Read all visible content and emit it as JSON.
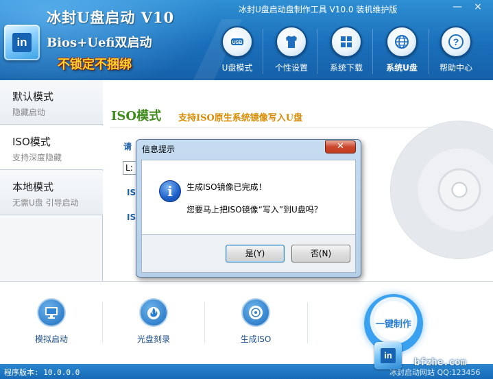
{
  "app": {
    "title": "冰封U盘启动 V10",
    "subtitle": "Bios+Uefi双启动",
    "slogan": "不锁定不捆绑",
    "logo_text": "in",
    "window_title": "冰封U盘启动盘制作工具 V10.0 装机维护版",
    "minimize_symbol": "—",
    "close_symbol": "×"
  },
  "nav": {
    "items": [
      {
        "label": "U盘模式",
        "icon": "usb-icon"
      },
      {
        "label": "个性设置",
        "icon": "tshirt-icon"
      },
      {
        "label": "系统下载",
        "icon": "windows-icon"
      },
      {
        "label": "系统U盘",
        "icon": "globe-icon",
        "active": true
      },
      {
        "label": "帮助中心",
        "icon": "question-icon"
      }
    ]
  },
  "modes": [
    {
      "title": "默认模式",
      "subtitle": "隐藏启动"
    },
    {
      "title": "ISO模式",
      "subtitle": "支持深度隐藏",
      "active": true
    },
    {
      "title": "本地模式",
      "subtitle": "无需U盘 引导启动"
    }
  ],
  "main": {
    "mode_title": "ISO模式",
    "mode_desc": "支持ISO原生系统镜像写入U盘",
    "select_prompt": "请",
    "drive_value": "L:",
    "iso_row1": "IS",
    "iso_row2": "IS"
  },
  "toolbar": {
    "items": [
      {
        "label": "模拟启动",
        "icon": "monitor-icon"
      },
      {
        "label": "光盘刻录",
        "icon": "flame-disc-icon"
      },
      {
        "label": "生成ISO",
        "icon": "disc-icon"
      }
    ],
    "one_click_label": "一键制作"
  },
  "status": {
    "version": "程序版本: 10.0.0.0",
    "right_text": "冰封启动网站 QQ:123456",
    "watermark_site": "bfzhe.com",
    "watermark_logo": "in"
  },
  "dialog": {
    "title": "信息提示",
    "close_symbol": "✕",
    "info_symbol": "i",
    "message_line1": "生成ISO镜像已完成！",
    "message_line2": "您要马上把ISO镜像“写入”到U盘吗？",
    "yes_label": "是(Y)",
    "no_label": "否(N)"
  },
  "colors": {
    "header_blue": "#1a6fba",
    "slogan_yellow": "#ffd230",
    "mode_title_green": "#3f8c1c",
    "mode_desc_orange": "#d88a00",
    "accent_blue": "#2a7fd6"
  }
}
